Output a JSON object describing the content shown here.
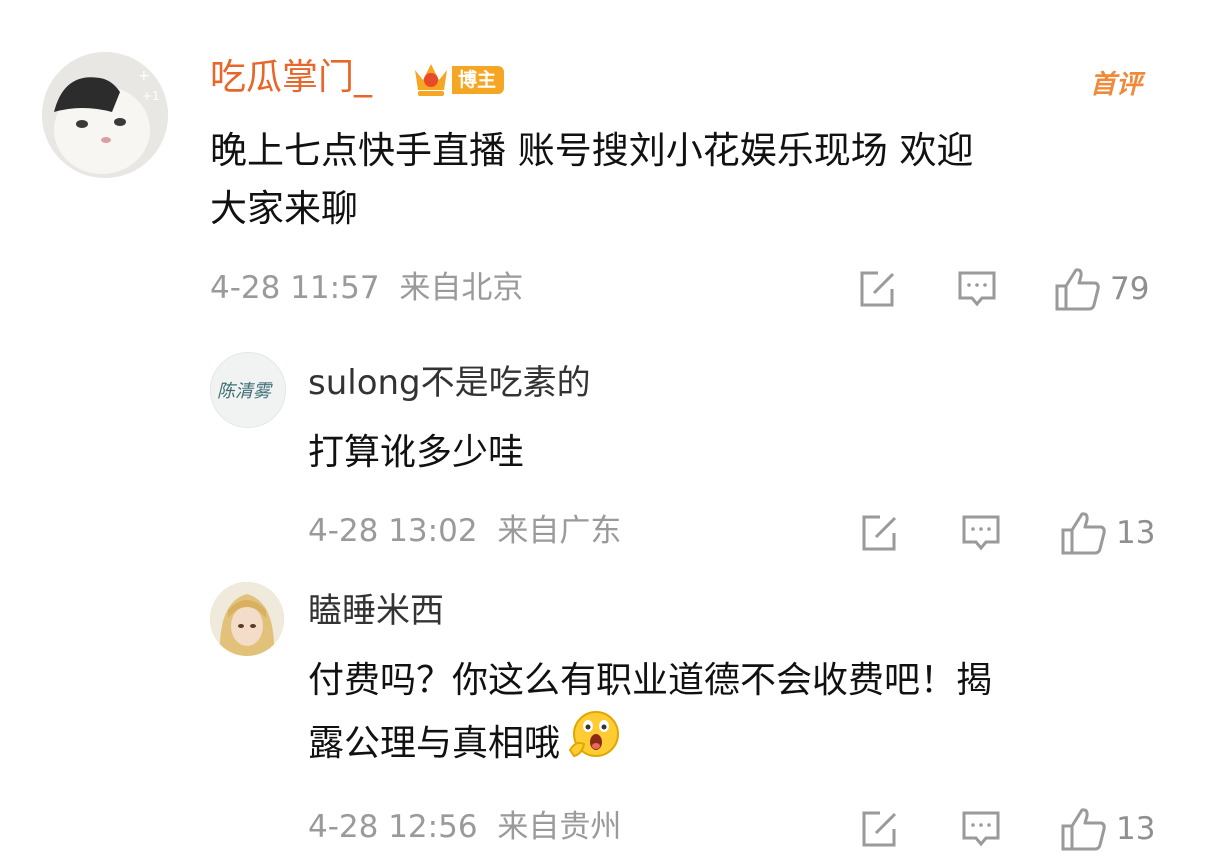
{
  "comments": [
    {
      "author": "吃瓜掌门_",
      "badge": "博主",
      "tag": "首评",
      "text_line1": "晚上七点快手直播 账号搜刘小花娱乐现场 欢迎",
      "text_line2": "大家来聊",
      "time": "4-28 11:57",
      "location": "来自北京",
      "likes": "79"
    },
    {
      "author": "sulong不是吃素的",
      "avatar_text": "陈清雾",
      "text_line1": "打算讹多少哇",
      "time": "4-28 13:02",
      "location": "来自广东",
      "likes": "13"
    },
    {
      "author": "瞌睡米西",
      "text_line1": "付费吗？你这么有职业道德不会收费吧！揭",
      "text_line2": "露公理与真相哦",
      "time": "4-28 12:56",
      "location": "来自贵州",
      "likes": "13"
    }
  ],
  "colors": {
    "author_main": "#e8662a",
    "badge": "#f5a623",
    "meta": "#9a9a9a",
    "icon": "#9a9a9a"
  },
  "icons": [
    "repost-icon",
    "comment-icon",
    "like-icon",
    "crown-icon",
    "emoji-shock-icon"
  ]
}
